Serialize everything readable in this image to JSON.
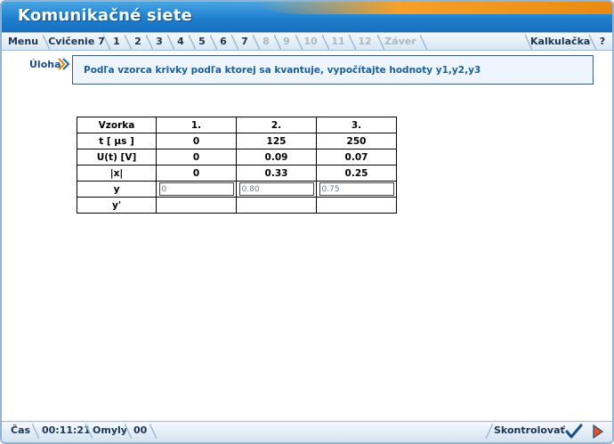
{
  "app": {
    "title": "Komunikačné siete"
  },
  "nav": {
    "menu": "Menu",
    "exercise": "Cvičenie 7",
    "steps": [
      {
        "label": "1",
        "enabled": true
      },
      {
        "label": "2",
        "enabled": true
      },
      {
        "label": "3",
        "enabled": true
      },
      {
        "label": "4",
        "enabled": true
      },
      {
        "label": "5",
        "enabled": true
      },
      {
        "label": "6",
        "enabled": true
      },
      {
        "label": "7",
        "enabled": true
      },
      {
        "label": "8",
        "enabled": false
      },
      {
        "label": "9",
        "enabled": false
      },
      {
        "label": "10",
        "enabled": false
      },
      {
        "label": "11",
        "enabled": false
      },
      {
        "label": "12",
        "enabled": false
      },
      {
        "label": "Záver",
        "enabled": false
      }
    ],
    "calculator": "Kalkulačka",
    "help": "?"
  },
  "task": {
    "label": "Úloha",
    "text": "Podľa vzorca krivky podľa ktorej sa kvantuje, vypočítajte hodnoty y1,y2,y3"
  },
  "table": {
    "headers": [
      "Vzorka",
      "1.",
      "2.",
      "3."
    ],
    "rows": [
      {
        "label": "t [ µs ]",
        "values": [
          "0",
          "125",
          "250"
        ]
      },
      {
        "label": "U(t) [V]",
        "values": [
          "0",
          "0.09",
          "0.07"
        ]
      },
      {
        "label": "|x|",
        "values": [
          "0",
          "0.33",
          "0.25"
        ]
      }
    ],
    "y_label": "y",
    "y_inputs": [
      "0",
      "0.80",
      "0.75"
    ],
    "yprime_label": "y'",
    "yprime_values": [
      "",
      "",
      ""
    ]
  },
  "status": {
    "time_label": "Čas",
    "time_value": "00:11:21",
    "errors_label": "Omyly",
    "errors_value": "00",
    "check_label": "Skontrolovať"
  },
  "icons": {
    "check": "checkmark-icon",
    "next": "next-arrow-icon",
    "task": "double-chevron-icon"
  },
  "colors": {
    "title_bar": "#1f7fcf",
    "accent_orange": "#f6a12a",
    "task_text": "#1b5e9c",
    "nav_text": "#1a3555"
  }
}
